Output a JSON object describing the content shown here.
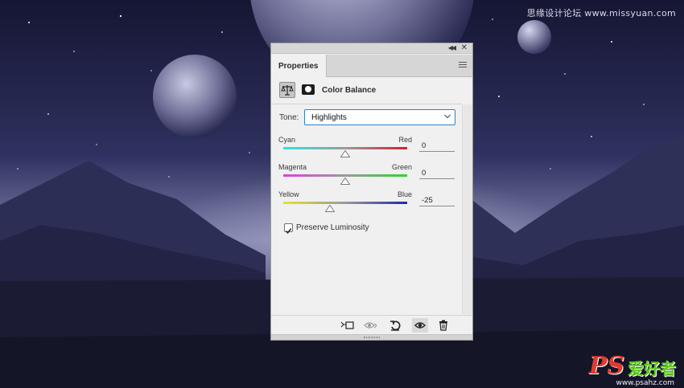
{
  "watermark": {
    "top": "思缘设计论坛 www.missyuan.com",
    "bottom_ps": "PS",
    "bottom_cn": "爱好者",
    "bottom_url": "www.psahz.com"
  },
  "panel": {
    "tab_label": "Properties",
    "adjustment_title": "Color Balance",
    "tone_label": "Tone:",
    "tone_value": "Highlights",
    "sliders": [
      {
        "left": "Cyan",
        "right": "Red",
        "value": "0",
        "level": 0,
        "left_color": "#2ee6e0",
        "right_color": "#d4202a"
      },
      {
        "left": "Magenta",
        "right": "Green",
        "value": "0",
        "level": 0,
        "left_color": "#e03ee0",
        "right_color": "#2ed42a"
      },
      {
        "left": "Yellow",
        "right": "Blue",
        "value": "-25",
        "level": -25,
        "left_color": "#e6e22a",
        "right_color": "#1d2aa8"
      }
    ],
    "preserve_luminosity_label": "Preserve Luminosity",
    "preserve_luminosity_checked": true,
    "bottom_icons": [
      "clip-to-layer-icon",
      "view-previous-state-icon",
      "reset-icon",
      "visibility-eye-icon",
      "trash-icon"
    ]
  }
}
